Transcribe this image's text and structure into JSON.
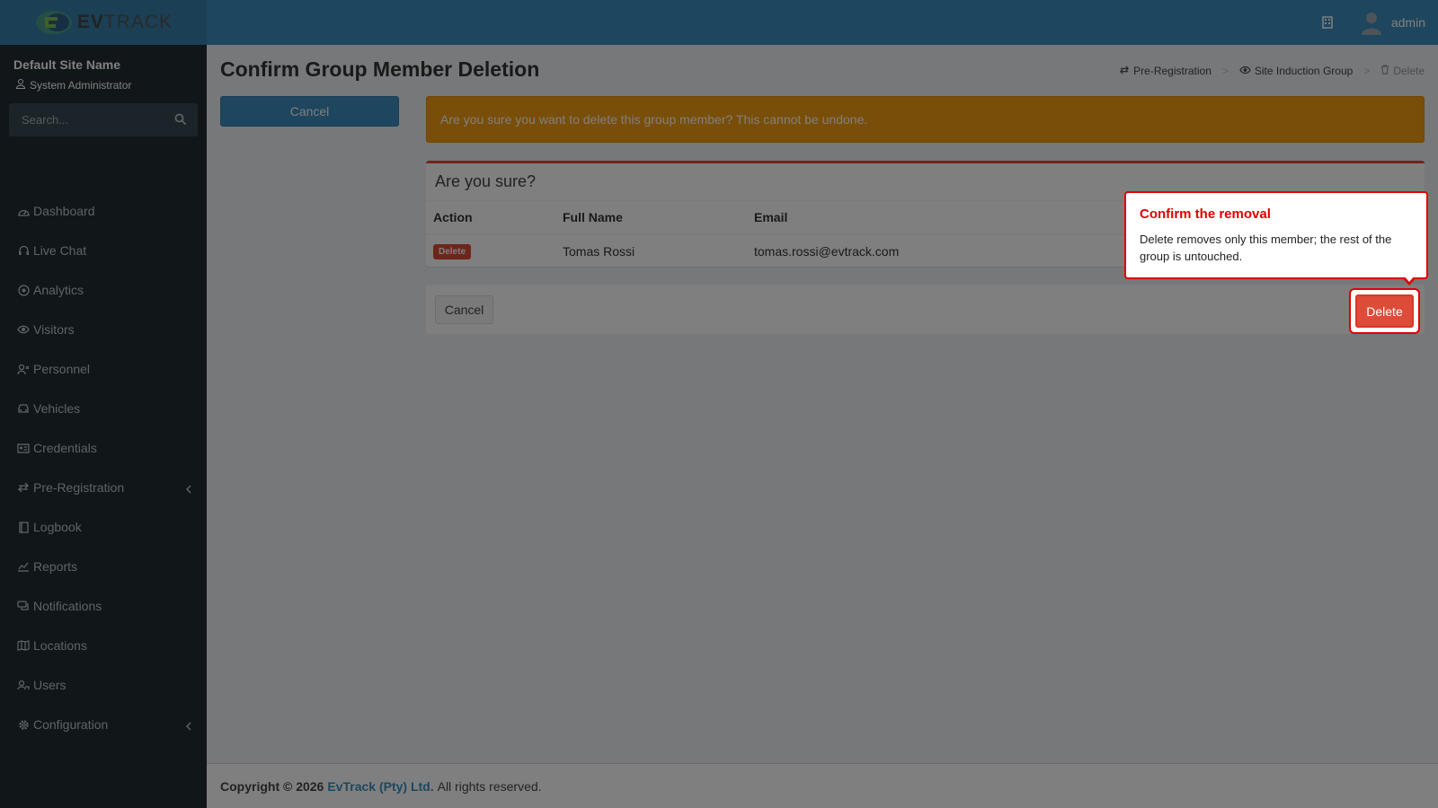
{
  "brand": {
    "name_bold": "EV",
    "name_light": "TRACK"
  },
  "header": {
    "username": "admin"
  },
  "sidebar": {
    "site_name": "Default Site Name",
    "role": "System Administrator",
    "search_placeholder": "Search...",
    "items": [
      {
        "label": "Dashboard",
        "icon": "dashboard-icon"
      },
      {
        "label": "Live Chat",
        "icon": "headset-icon"
      },
      {
        "label": "Analytics",
        "icon": "analytics-icon"
      },
      {
        "label": "Visitors",
        "icon": "eye-icon"
      },
      {
        "label": "Personnel",
        "icon": "personnel-icon"
      },
      {
        "label": "Vehicles",
        "icon": "car-icon"
      },
      {
        "label": "Credentials",
        "icon": "id-card-icon"
      },
      {
        "label": "Pre-Registration",
        "icon": "exchange-icon",
        "has_children": true
      },
      {
        "label": "Logbook",
        "icon": "book-icon"
      },
      {
        "label": "Reports",
        "icon": "chart-icon"
      },
      {
        "label": "Notifications",
        "icon": "comments-icon"
      },
      {
        "label": "Locations",
        "icon": "map-icon"
      },
      {
        "label": "Users",
        "icon": "users-icon"
      },
      {
        "label": "Configuration",
        "icon": "cog-icon",
        "has_children": true
      }
    ]
  },
  "page": {
    "title": "Confirm Group Member Deletion",
    "breadcrumb": [
      {
        "label": "Pre-Registration",
        "icon": "exchange-icon"
      },
      {
        "label": "Site Induction Group",
        "icon": "eye-icon"
      },
      {
        "label": "Delete",
        "icon": "trash-icon"
      }
    ],
    "cancel_label": "Cancel",
    "warning": "Are you sure you want to delete this group member? This cannot be undone.",
    "box_title": "Are you sure?",
    "table": {
      "headers": [
        "Action",
        "Full Name",
        "Email"
      ],
      "rows": [
        {
          "action": "Delete",
          "full_name": "Tomas Rossi",
          "email": "tomas.rossi@evtrack.com"
        }
      ]
    },
    "footer_cancel_label": "Cancel",
    "delete_label": "Delete"
  },
  "tooltip": {
    "title": "Confirm the removal",
    "body": "Delete removes only this member; the rest of the group is untouched."
  },
  "footer": {
    "copyright": "Copyright © 2026",
    "company": "EvTrack (Pty) Ltd.",
    "rights": "All rights reserved."
  },
  "colors": {
    "header": "#3c8dbc",
    "sidebar": "#222d32",
    "warning": "#f39c12",
    "danger": "#dd4b39",
    "highlight": "#e00000"
  }
}
